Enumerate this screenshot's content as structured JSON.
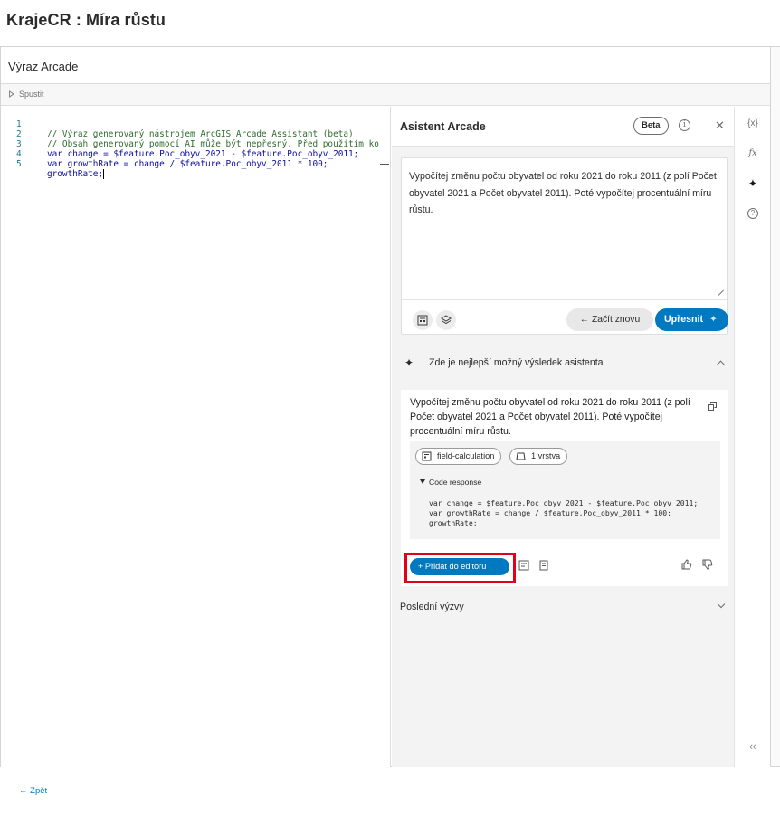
{
  "page": {
    "title": "KrajeCR : Míra růstu"
  },
  "header": {
    "title": "Výraz Arcade"
  },
  "toolbar": {
    "run_label": "Spustit"
  },
  "editor": {
    "lines": [
      {
        "num": "1",
        "text": "// Výraz generovaný nástrojem ArcGIS Arcade Assistant (beta)"
      },
      {
        "num": "2",
        "text": "// Obsah generovaný pomocí AI může být nepřesný. Před použitím ko"
      },
      {
        "num": "3",
        "text": "var change = $feature.Poc_obyv_2021 - $feature.Poc_obyv_2011;"
      },
      {
        "num": "4",
        "text": "var growthRate = change / $feature.Poc_obyv_2011 * 100;"
      },
      {
        "num": "5",
        "text": "growthRate;"
      }
    ]
  },
  "assistant": {
    "title": "Asistent Arcade",
    "badge": "Beta",
    "prompt": "Vypočítej změnu počtu obyvatel od roku 2021 do roku 2011 (z polí Počet obyvatel 2021 a Počet obyvatel 2011). Poté vypočítej procentuální míru růstu.",
    "restart_label": "← Začít znovu",
    "refine_label": "Upřesnit",
    "result_header": "Zde je nejlepší možný výsledek asistenta",
    "result": {
      "text": "Vypočítej změnu počtu obyvatel od roku 2021 do roku 2011 (z polí Počet obyvatel 2021 a Počet obyvatel 2011). Poté vypočítej procentuální míru růstu.",
      "chips": [
        "field-calculation",
        "1 vrstva"
      ],
      "code_toggle": "Code response",
      "code": "var change = $feature.Poc_obyv_2021 - $feature.Poc_obyv_2011;\nvar growthRate = change / $feature.Poc_obyv_2011 * 100;\ngrowthRate;",
      "add_label": "+ Přidat do editoru"
    },
    "recent_label": "Poslední výzvy"
  },
  "rail": {
    "variables": "{x}",
    "functions": "fx",
    "help": "?"
  },
  "footer": {
    "back_label": "← Zpět"
  },
  "colors": {
    "accent": "#0079c1",
    "highlight": "#e3001b"
  }
}
